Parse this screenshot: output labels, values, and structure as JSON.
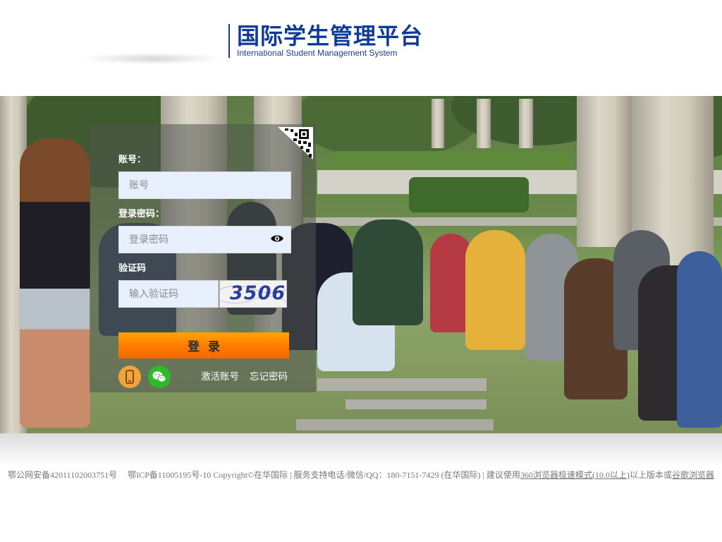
{
  "header": {
    "title_cn": "国际学生管理平台",
    "title_en": "International Student Management System"
  },
  "login": {
    "account_label": "账号：",
    "account_placeholder": "账号",
    "password_label": "登录密码：",
    "password_placeholder": "登录密码",
    "captcha_label": "验证码",
    "captcha_placeholder": "输入验证码",
    "captcha_text": "3506",
    "submit_label": "登录",
    "activate_link": "激活账号",
    "forgot_link": "忘记密码"
  },
  "footer": {
    "police_record": "鄂公网安备42011102003751号",
    "icp_text": "鄂ICP备11005195号-10 Copyright©在华国际 | 服务支持电话/微信/QQ：180-7151-7429 (在华国际) | 建议使用",
    "browser_link_1": "360浏览器极速模式(10.0以上)",
    "mid_text": "以上版本或",
    "browser_link_2": "谷歌浏览器"
  },
  "colors": {
    "brand_blue": "#0f3a96",
    "button_orange": "#ff7a00",
    "wechat_green": "#2dbb2a",
    "phone_orange": "#f2a33a"
  },
  "icons": [
    "qr-code-icon",
    "eye-icon",
    "phone-icon",
    "wechat-icon"
  ]
}
